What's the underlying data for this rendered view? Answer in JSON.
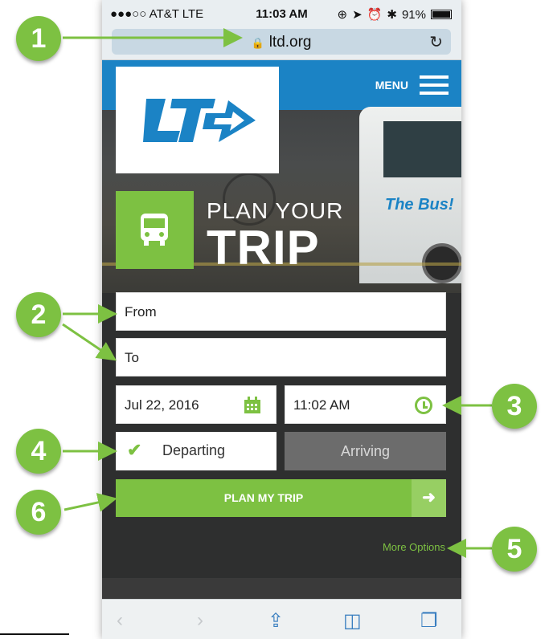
{
  "status_bar": {
    "carrier": "●●●○○ AT&T  LTE",
    "time": "11:03 AM",
    "battery": "91%"
  },
  "address_bar": {
    "url": "ltd.org"
  },
  "header": {
    "menu_label": "MENU",
    "logo_text": "LTD",
    "bus_text": "The Bus!"
  },
  "plan": {
    "heading_small": "PLAN YOUR",
    "heading_large": "TRIP"
  },
  "form": {
    "from_placeholder": "From",
    "to_placeholder": "To",
    "date_value": "Jul 22, 2016",
    "time_value": "11:02 AM",
    "departing_label": "Departing",
    "arriving_label": "Arriving",
    "plan_button_label": "PLAN MY TRIP",
    "more_options_label": "More Options"
  },
  "callouts": [
    "1",
    "2",
    "3",
    "4",
    "5",
    "6"
  ],
  "colors": {
    "brand_green": "#7dc142",
    "brand_blue": "#1b83c5",
    "form_bg": "#2e2f2f"
  }
}
